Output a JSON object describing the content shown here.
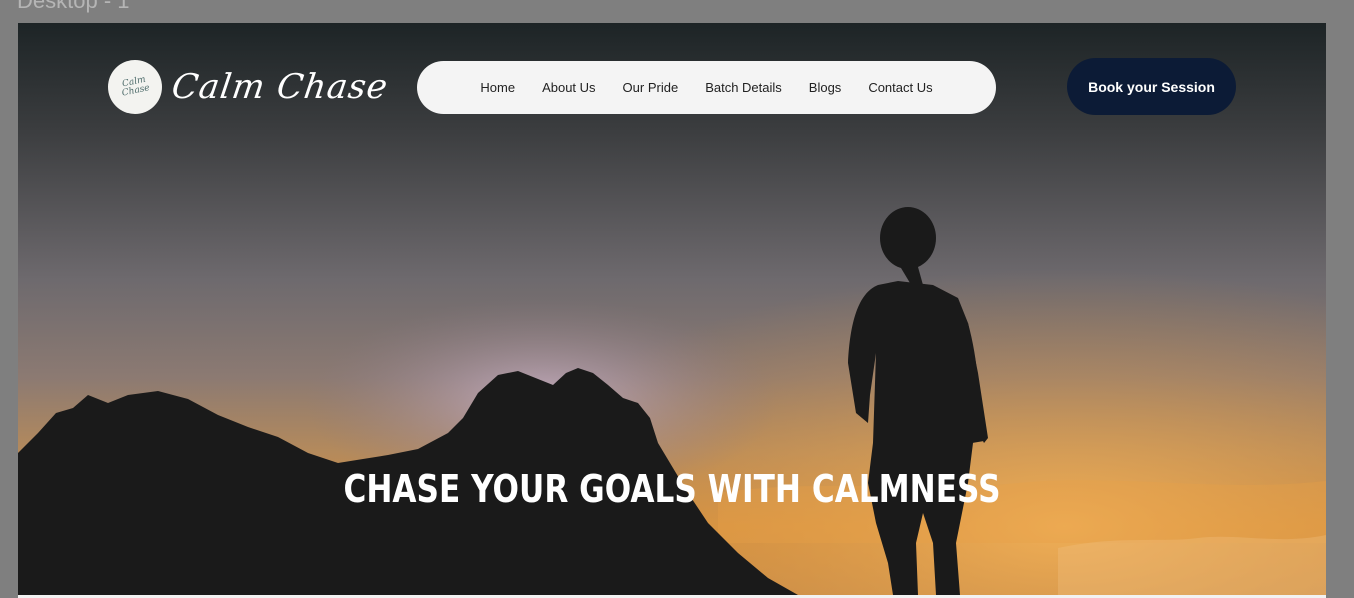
{
  "frame": {
    "label": "Desktop - 1"
  },
  "logo": {
    "badge_text": "Calm Chase",
    "wordmark": "Calm Chase"
  },
  "nav": {
    "items": [
      {
        "label": "Home"
      },
      {
        "label": "About Us"
      },
      {
        "label": "Our Pride"
      },
      {
        "label": "Batch Details"
      },
      {
        "label": "Blogs"
      },
      {
        "label": "Contact Us"
      }
    ]
  },
  "cta": {
    "label": "Book your Session"
  },
  "hero": {
    "headline": "CHASE YOUR GOALS WITH CALMNESS"
  },
  "colors": {
    "cta_bg": "#0c1b36",
    "nav_bg": "#f4f4f4",
    "sunset": "#e9a045"
  }
}
